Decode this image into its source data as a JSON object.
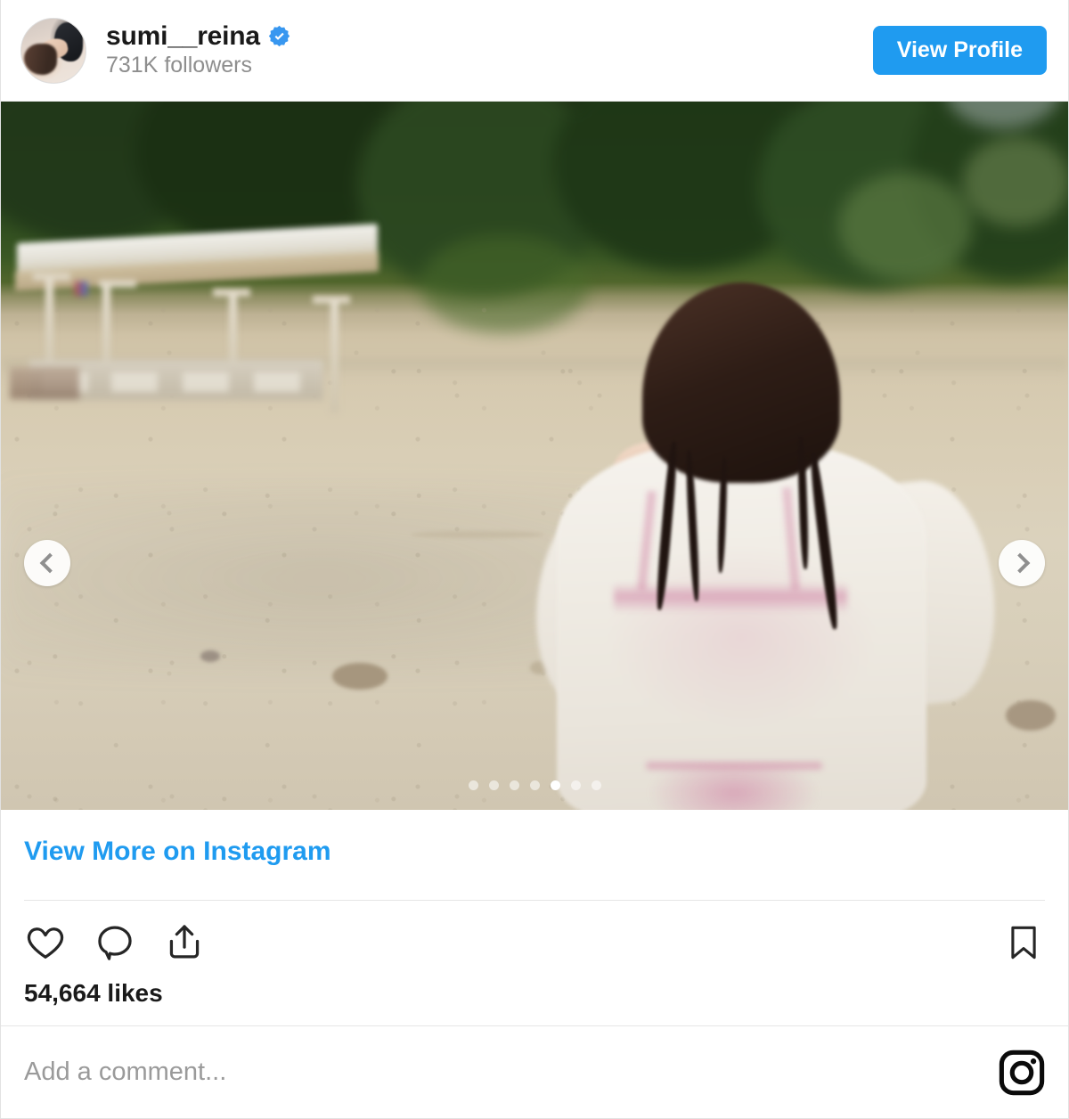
{
  "header": {
    "avatar_name": "avatar",
    "username": "sumi__reina",
    "verified": true,
    "verified_icon": "verified-badge-icon",
    "followers": "731K followers",
    "view_profile_label": "View Profile"
  },
  "media": {
    "type": "carousel",
    "alt": "Woman with wet dark hair seen from behind on a sandy beach, wearing a sheer white knit top over a pink bikini, blurred beach pavilion and green foliage in the background",
    "prev_icon": "chevron-left-icon",
    "next_icon": "chevron-right-icon",
    "dots_total": 7,
    "dots_active_index": 4
  },
  "caption": {
    "view_more_label": "View More on Instagram"
  },
  "actions": {
    "like_icon": "heart-icon",
    "comment_icon": "comment-bubble-icon",
    "share_icon": "share-icon",
    "save_icon": "bookmark-icon",
    "likes_text": "54,664 likes"
  },
  "comment_bar": {
    "placeholder": "Add a comment...",
    "logo_icon": "instagram-logo-icon"
  },
  "colors": {
    "accent_blue": "#1f9bf0",
    "verified_blue": "#3897f0",
    "text_primary": "#1a1a1a",
    "text_muted": "#8e8e8e",
    "border": "#e6e6e6",
    "card_bg": "#ffffff"
  }
}
